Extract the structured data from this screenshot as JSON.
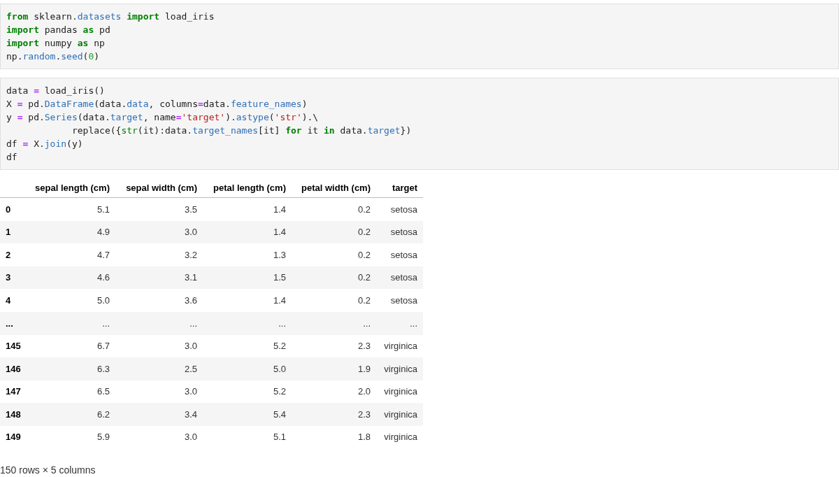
{
  "cells": [
    {
      "lines": [
        [
          {
            "t": "from",
            "kind": "keyword"
          },
          {
            "t": " sklearn.",
            "kind": "plain"
          },
          {
            "t": "datasets",
            "kind": "attr"
          },
          {
            "t": " import",
            "kind": "keyword"
          },
          {
            "t": " load_iris",
            "kind": "plain"
          }
        ],
        [
          {
            "t": "import",
            "kind": "keyword"
          },
          {
            "t": " pandas ",
            "kind": "plain"
          },
          {
            "t": "as",
            "kind": "keyword"
          },
          {
            "t": " pd",
            "kind": "plain"
          }
        ],
        [
          {
            "t": "import",
            "kind": "keyword"
          },
          {
            "t": " numpy ",
            "kind": "plain"
          },
          {
            "t": "as",
            "kind": "keyword"
          },
          {
            "t": " np",
            "kind": "plain"
          }
        ],
        [
          {
            "t": "np.",
            "kind": "plain"
          },
          {
            "t": "random",
            "kind": "attr"
          },
          {
            "t": ".",
            "kind": "plain"
          },
          {
            "t": "seed",
            "kind": "attr"
          },
          {
            "t": "(",
            "kind": "plain"
          },
          {
            "t": "0",
            "kind": "number"
          },
          {
            "t": ")",
            "kind": "plain"
          }
        ]
      ]
    },
    {
      "lines": [
        [
          {
            "t": "data ",
            "kind": "plain"
          },
          {
            "t": "=",
            "kind": "op"
          },
          {
            "t": " load_iris()",
            "kind": "plain"
          }
        ],
        [
          {
            "t": "X ",
            "kind": "plain"
          },
          {
            "t": "=",
            "kind": "op"
          },
          {
            "t": " pd.",
            "kind": "plain"
          },
          {
            "t": "DataFrame",
            "kind": "attr"
          },
          {
            "t": "(data.",
            "kind": "plain"
          },
          {
            "t": "data",
            "kind": "attr"
          },
          {
            "t": ", columns",
            "kind": "plain"
          },
          {
            "t": "=",
            "kind": "op"
          },
          {
            "t": "data.",
            "kind": "plain"
          },
          {
            "t": "feature_names",
            "kind": "attr"
          },
          {
            "t": ")",
            "kind": "plain"
          }
        ],
        [
          {
            "t": "y ",
            "kind": "plain"
          },
          {
            "t": "=",
            "kind": "op"
          },
          {
            "t": " pd.",
            "kind": "plain"
          },
          {
            "t": "Series",
            "kind": "attr"
          },
          {
            "t": "(data.",
            "kind": "plain"
          },
          {
            "t": "target",
            "kind": "attr"
          },
          {
            "t": ", name",
            "kind": "plain"
          },
          {
            "t": "=",
            "kind": "op"
          },
          {
            "t": "'target'",
            "kind": "string"
          },
          {
            "t": ").",
            "kind": "plain"
          },
          {
            "t": "astype",
            "kind": "attr"
          },
          {
            "t": "(",
            "kind": "plain"
          },
          {
            "t": "'str'",
            "kind": "string"
          },
          {
            "t": ").\\",
            "kind": "plain"
          }
        ],
        [
          {
            "t": "            replace({",
            "kind": "plain"
          },
          {
            "t": "str",
            "kind": "builtin"
          },
          {
            "t": "(it):data.",
            "kind": "plain"
          },
          {
            "t": "target_names",
            "kind": "attr"
          },
          {
            "t": "[it] ",
            "kind": "plain"
          },
          {
            "t": "for",
            "kind": "keyword"
          },
          {
            "t": " it ",
            "kind": "plain"
          },
          {
            "t": "in",
            "kind": "keyword"
          },
          {
            "t": " data.",
            "kind": "plain"
          },
          {
            "t": "target",
            "kind": "attr"
          },
          {
            "t": "})",
            "kind": "plain"
          }
        ],
        [
          {
            "t": "df ",
            "kind": "plain"
          },
          {
            "t": "=",
            "kind": "op"
          },
          {
            "t": " X.",
            "kind": "plain"
          },
          {
            "t": "join",
            "kind": "attr"
          },
          {
            "t": "(y)",
            "kind": "plain"
          }
        ],
        [
          {
            "t": "df",
            "kind": "plain"
          }
        ]
      ]
    }
  ],
  "table": {
    "columns": [
      "sepal length (cm)",
      "sepal width (cm)",
      "petal length (cm)",
      "petal width (cm)",
      "target"
    ],
    "rows": [
      {
        "index": "0",
        "cells": [
          "5.1",
          "3.5",
          "1.4",
          "0.2",
          "setosa"
        ]
      },
      {
        "index": "1",
        "cells": [
          "4.9",
          "3.0",
          "1.4",
          "0.2",
          "setosa"
        ]
      },
      {
        "index": "2",
        "cells": [
          "4.7",
          "3.2",
          "1.3",
          "0.2",
          "setosa"
        ]
      },
      {
        "index": "3",
        "cells": [
          "4.6",
          "3.1",
          "1.5",
          "0.2",
          "setosa"
        ]
      },
      {
        "index": "4",
        "cells": [
          "5.0",
          "3.6",
          "1.4",
          "0.2",
          "setosa"
        ]
      },
      {
        "index": "...",
        "cells": [
          "...",
          "...",
          "...",
          "...",
          "..."
        ]
      },
      {
        "index": "145",
        "cells": [
          "6.7",
          "3.0",
          "5.2",
          "2.3",
          "virginica"
        ]
      },
      {
        "index": "146",
        "cells": [
          "6.3",
          "2.5",
          "5.0",
          "1.9",
          "virginica"
        ]
      },
      {
        "index": "147",
        "cells": [
          "6.5",
          "3.0",
          "5.2",
          "2.0",
          "virginica"
        ]
      },
      {
        "index": "148",
        "cells": [
          "6.2",
          "3.4",
          "5.4",
          "2.3",
          "virginica"
        ]
      },
      {
        "index": "149",
        "cells": [
          "5.9",
          "3.0",
          "5.1",
          "1.8",
          "virginica"
        ]
      }
    ]
  },
  "summary": "150 rows × 5 columns"
}
